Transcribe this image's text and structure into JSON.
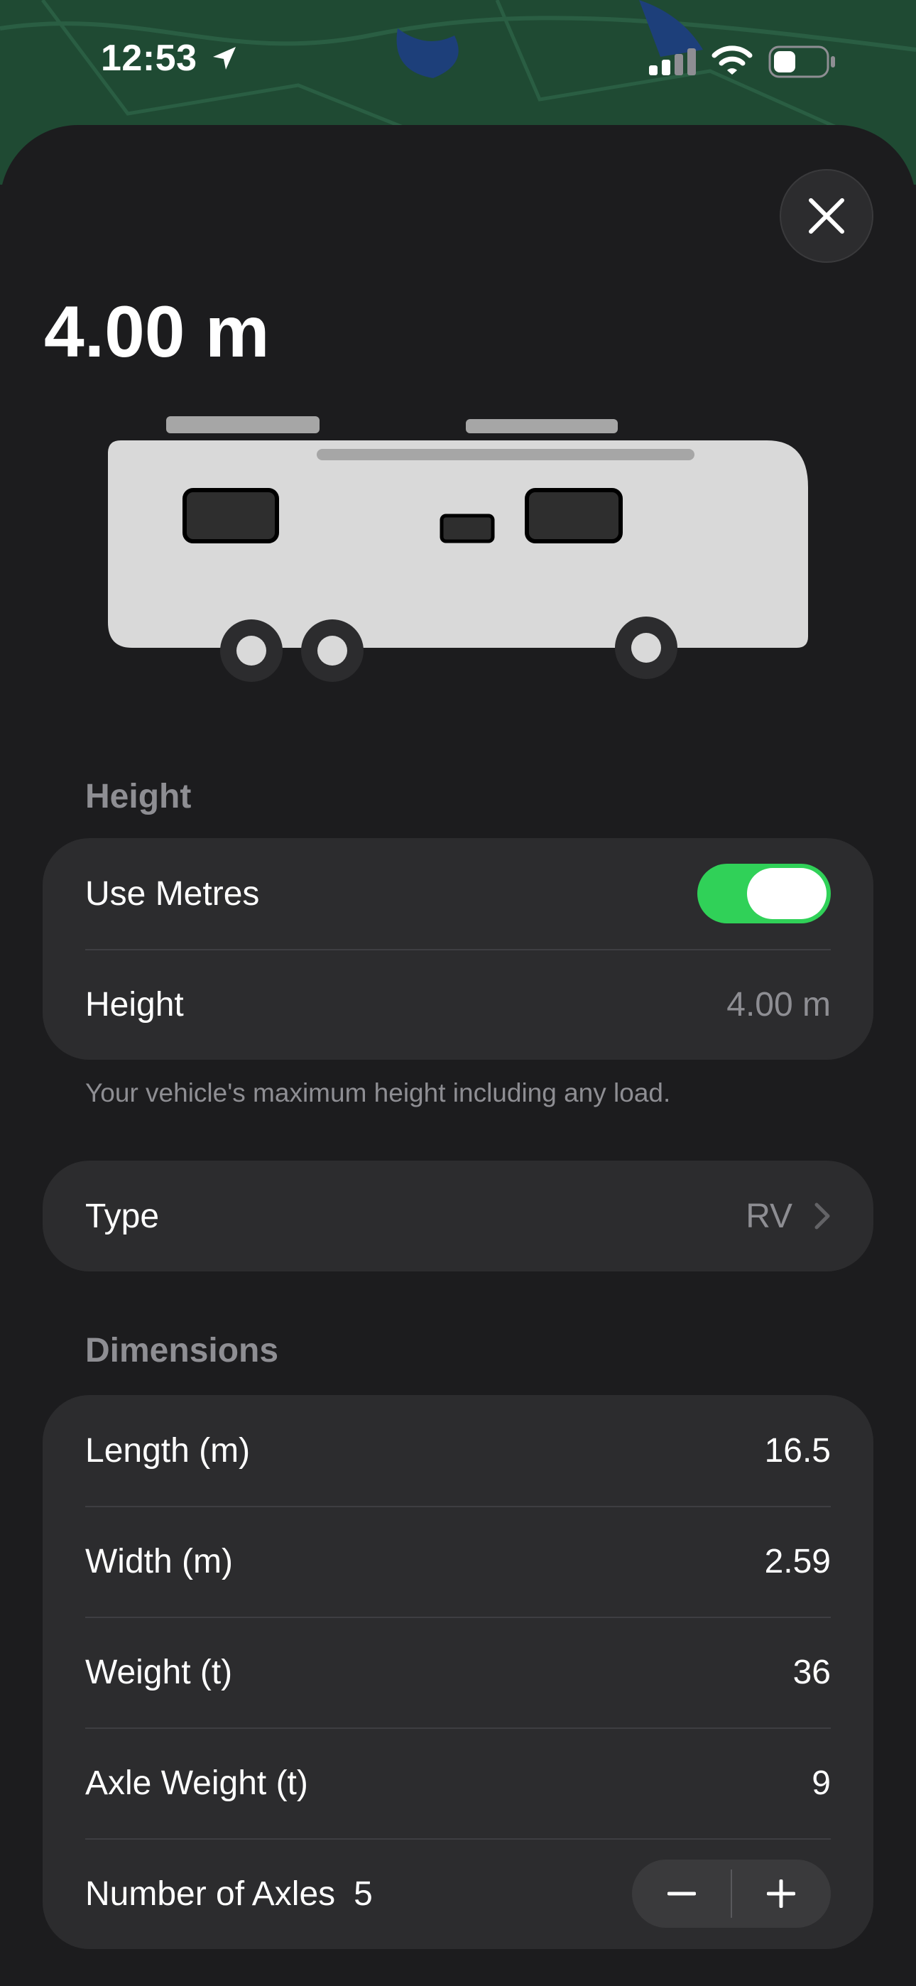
{
  "status_bar": {
    "time": "12:53",
    "icons": [
      "location-arrow-icon",
      "cellular-signal-icon",
      "wifi-icon",
      "battery-icon"
    ]
  },
  "header": {
    "title": "4.00 m",
    "close_icon": "close-icon"
  },
  "vehicle_illustration": {
    "icon": "rv-icon",
    "body_color": "#d9d9d9"
  },
  "height_section": {
    "label": "Height",
    "use_metres_label": "Use Metres",
    "use_metres_on": true,
    "height_label": "Height",
    "height_value": "4.00 m",
    "footnote": "Your vehicle's maximum height including any load."
  },
  "type_row": {
    "label": "Type",
    "value": "RV"
  },
  "dimensions_section": {
    "label": "Dimensions",
    "rows": [
      {
        "label": "Length (m)",
        "value": "16.5"
      },
      {
        "label": "Width (m)",
        "value": "2.59"
      },
      {
        "label": "Weight (t)",
        "value": "36"
      },
      {
        "label": "Axle Weight (t)",
        "value": "9"
      }
    ],
    "axles_label": "Number of Axles",
    "axles_value": "5",
    "minus_icon": "minus-icon",
    "plus_icon": "plus-icon"
  },
  "colors": {
    "background": "#1c1c1e",
    "card": "#2c2c2e",
    "accent_green": "#30d158",
    "secondary_text": "#8e8e93"
  }
}
